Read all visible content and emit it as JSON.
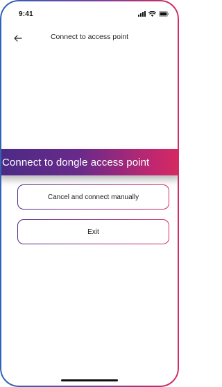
{
  "status_bar": {
    "time": "9:41",
    "icons": [
      "signal-icon",
      "wifi-icon",
      "battery-icon"
    ]
  },
  "header": {
    "back_icon": "arrow-left-icon",
    "title": "Connect to access point"
  },
  "banner": {
    "text": "Connect to dongle access point"
  },
  "buttons": {
    "cancel_label": "Cancel and connect manually",
    "exit_label": "Exit"
  },
  "colors": {
    "gradient_start": "#4b2a86",
    "gradient_end": "#d62a5f",
    "background": "#ffffff",
    "text": "#1a1a1a"
  }
}
